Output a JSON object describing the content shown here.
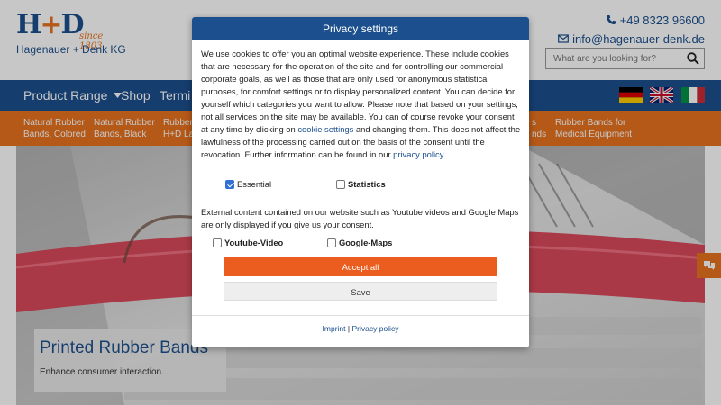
{
  "header": {
    "logo_mark": "H+D",
    "logo_since": "since 1803",
    "logo_name": "Hagenauer + Denk KG",
    "phone": "+49 8323 96600",
    "email": "info@hagenauer-denk.de",
    "search_placeholder": "What are you looking for?"
  },
  "nav": {
    "items": [
      "Product Range",
      "Shop",
      "Termi"
    ],
    "flags": [
      "german-flag-icon",
      "uk-flag-icon",
      "italian-flag-icon"
    ],
    "color": "#1b4f8d"
  },
  "subnav": {
    "color": "#e8731f",
    "items": [
      {
        "line1": "Natural Rubber",
        "line2": "Bands, Colored"
      },
      {
        "line1": "Natural Rubber",
        "line2": "Bands, Black"
      },
      {
        "line1": "Rubber",
        "line2": "H+D La"
      },
      {
        "line1": "s",
        "line2": "nds"
      },
      {
        "line1": "Rubber Bands for",
        "line2": "Medical Equipment"
      }
    ]
  },
  "hero": {
    "title": "Printed Rubber Bands",
    "subtitle": "Enhance consumer interaction."
  },
  "modal": {
    "title": "Privacy settings",
    "text_before_link1": "We use cookies to offer you an optimal website experience. These include cookies that are necessary for the operation of the site and for controlling our commercial corporate goals, as well as those that are only used for anonymous statistical purposes, for comfort settings or to display personalized content. You can decide for yourself which categories you want to allow. Please note that based on your settings, not all services on the site may be available. You can of course revoke your consent at any time by clicking on ",
    "link1": "cookie settings",
    "text_between": " and changing them. This does not affect the lawfulness of the processing carried out on the basis of the consent until the revocation. Further information can be found in our ",
    "link2": "privacy policy",
    "text_after": ".",
    "checkbox_essential": {
      "label": "Essential",
      "checked": true
    },
    "checkbox_statistics": {
      "label": "Statistics",
      "checked": false
    },
    "external_text": "External content contained on our website such as Youtube videos and Google Maps are only displayed if you give us your consent.",
    "checkbox_youtube": {
      "label": "Youtube-Video",
      "checked": false
    },
    "checkbox_maps": {
      "label": "Google-Maps",
      "checked": false
    },
    "accept_label": "Accept all",
    "save_label": "Save",
    "imprint_label": "Imprint",
    "separator": "|",
    "privacy_label": "Privacy policy",
    "accent_color": "#ea5d1e"
  }
}
